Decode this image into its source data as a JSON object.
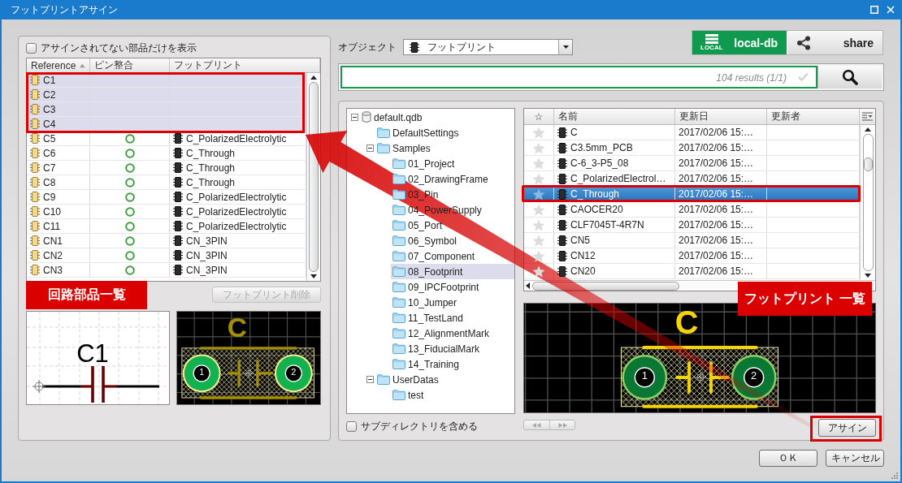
{
  "window": {
    "title": "フットプリントアサイン"
  },
  "parts_panel": {
    "filter": {
      "label": "アサインされてない部品だけを表示",
      "checked": false
    },
    "columns": [
      {
        "label": "Reference",
        "sort_ascending": true
      },
      {
        "label": "ピン整合"
      },
      {
        "label": "フットプリント"
      }
    ],
    "rows": [
      {
        "reference": "C1",
        "pin_match": false,
        "selected": true
      },
      {
        "reference": "C2",
        "pin_match": false,
        "selected": true
      },
      {
        "reference": "C3",
        "pin_match": false,
        "selected": true
      },
      {
        "reference": "C4",
        "pin_match": false,
        "selected": true
      },
      {
        "reference": "C5",
        "pin_match": true,
        "footprint": "C_PolarizedElectrolytic",
        "selected": false
      },
      {
        "reference": "C6",
        "pin_match": true,
        "footprint": "C_Through",
        "selected": false
      },
      {
        "reference": "C7",
        "pin_match": true,
        "footprint": "C_Through",
        "selected": false
      },
      {
        "reference": "C8",
        "pin_match": true,
        "footprint": "C_Through",
        "selected": false
      },
      {
        "reference": "C9",
        "pin_match": true,
        "footprint": "C_PolarizedElectrolytic",
        "selected": false
      },
      {
        "reference": "C10",
        "pin_match": true,
        "footprint": "C_PolarizedElectrolytic",
        "selected": false
      },
      {
        "reference": "C11",
        "pin_match": true,
        "footprint": "C_PolarizedElectrolytic",
        "selected": false
      },
      {
        "reference": "CN1",
        "pin_match": true,
        "footprint": "CN_3PIN",
        "selected": false
      },
      {
        "reference": "CN2",
        "pin_match": true,
        "footprint": "CN_3PIN",
        "selected": false
      },
      {
        "reference": "CN3",
        "pin_match": true,
        "footprint": "CN_3PIN",
        "selected": false
      }
    ],
    "callout": "回路部品一覧",
    "delete_button": {
      "label": "フットプリント削除",
      "disabled": true
    },
    "symbol_preview": {
      "label": "C1"
    },
    "footprint_preview": {
      "label": "C",
      "pads": [
        "1",
        "2"
      ]
    }
  },
  "object_type": {
    "label": "オブジェクト",
    "value": "フットプリント"
  },
  "db_buttons": [
    {
      "kind": "local",
      "label": "local-db",
      "icon_caption": "LOCAL",
      "selected": true
    },
    {
      "kind": "share",
      "label": "share",
      "selected": false
    }
  ],
  "search": {
    "status": "104 results (1/1)"
  },
  "library_panel": {
    "tree": [
      {
        "kind": "database",
        "label": "default.qdb",
        "expanded": true,
        "selected": false,
        "children": [
          {
            "kind": "folder",
            "label": "DefaultSettings",
            "selected": false
          },
          {
            "kind": "folder",
            "label": "Samples",
            "expanded": true,
            "selected": false,
            "children": [
              {
                "kind": "folder",
                "label": "01_Project",
                "selected": false
              },
              {
                "kind": "folder",
                "label": "02_DrawingFrame",
                "selected": false
              },
              {
                "kind": "folder",
                "label": "03_Pin",
                "selected": false
              },
              {
                "kind": "folder",
                "label": "04_PowerSupply",
                "selected": false
              },
              {
                "kind": "folder",
                "label": "05_Port",
                "selected": false
              },
              {
                "kind": "folder",
                "label": "06_Symbol",
                "selected": false
              },
              {
                "kind": "folder",
                "label": "07_Component",
                "selected": false
              },
              {
                "kind": "folder",
                "label": "08_Footprint",
                "selected": true
              },
              {
                "kind": "folder",
                "label": "09_IPCFootprint",
                "selected": false
              },
              {
                "kind": "folder",
                "label": "10_Jumper",
                "selected": false
              },
              {
                "kind": "folder",
                "label": "11_TestLand",
                "selected": false
              },
              {
                "kind": "folder",
                "label": "12_AlignmentMark",
                "selected": false
              },
              {
                "kind": "folder",
                "label": "13_FiducialMark",
                "selected": false
              },
              {
                "kind": "folder",
                "label": "14_Training",
                "selected": false
              }
            ]
          },
          {
            "kind": "folder",
            "label": "UserDatas",
            "expanded": true,
            "selected": false,
            "children": [
              {
                "kind": "folder",
                "label": "test",
                "selected": false
              }
            ]
          }
        ]
      }
    ],
    "include_subdirectories": {
      "label": "サブディレクトリを含める",
      "checked": false
    },
    "table": {
      "columns": [
        {
          "label": "☆"
        },
        {
          "label": "名前"
        },
        {
          "label": "更新日"
        },
        {
          "label": "更新者"
        }
      ],
      "rows": [
        {
          "favorite": false,
          "name": "C",
          "updated": "2017/02/06 15:…",
          "selected": false
        },
        {
          "favorite": false,
          "name": "C3.5mm_PCB",
          "updated": "2017/02/06 15:…",
          "selected": false
        },
        {
          "favorite": false,
          "name": "C-6_3-P5_08",
          "updated": "2017/02/06 15:…",
          "selected": false
        },
        {
          "favorite": false,
          "name": "C_PolarizedElectrol…",
          "updated": "2017/02/06 15:…",
          "selected": false
        },
        {
          "favorite": false,
          "name": "C_Through",
          "updated": "2017/02/06 15:…",
          "selected": true
        },
        {
          "favorite": false,
          "name": "CAOCER20",
          "updated": "2017/02/06 15:…",
          "selected": false
        },
        {
          "favorite": false,
          "name": "CLF7045T-4R7N",
          "updated": "2017/02/06 15:…",
          "selected": false
        },
        {
          "favorite": false,
          "name": "CN5",
          "updated": "2017/02/06 15:…",
          "selected": false
        },
        {
          "favorite": false,
          "name": "CN12",
          "updated": "2017/02/06 15:…",
          "selected": false
        },
        {
          "favorite": false,
          "name": "CN20",
          "updated": "2017/02/06 15:…",
          "selected": false
        }
      ]
    },
    "callout": "フットプリント 一覧",
    "footprint_preview": {
      "label": "C",
      "pads": [
        "1",
        "2"
      ]
    },
    "assign_button": {
      "label": "アサイン"
    }
  },
  "dialog_buttons": [
    {
      "label": "ＯＫ"
    },
    {
      "label": "キャンセル"
    }
  ]
}
